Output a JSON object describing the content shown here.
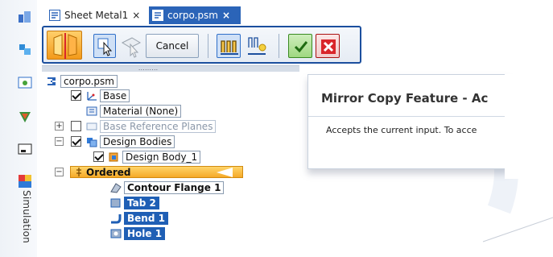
{
  "tabs": [
    {
      "label": "Sheet Metal1",
      "close": "×"
    },
    {
      "label": "corpo.psm",
      "close": "×"
    }
  ],
  "command_bar": {
    "cancel_label": "Cancel",
    "grip_dots": "........."
  },
  "left_toolbar": {
    "simulation_label": "Simulation",
    "icons": [
      "assembly-icon",
      "parts-icon",
      "view-icon",
      "sim-icon",
      "display-icon",
      "simulation-color-icon"
    ]
  },
  "tree": {
    "root": "corpo.psm",
    "base": "Base",
    "material": "Material (None)",
    "ref_planes": "Base Reference Planes",
    "design_bodies": "Design Bodies",
    "design_body_1": "Design Body_1",
    "ordered": "Ordered",
    "features": [
      "Contour Flange 1",
      "Tab 2",
      "Bend 1",
      "Hole 1"
    ]
  },
  "tooltip": {
    "title": "Mirror Copy Feature - Ac",
    "body": "Accepts the current input.  To acce"
  },
  "colors": {
    "accent": "#2b64b8",
    "ordered": "#f5a928",
    "selection": "#1f5fb5"
  }
}
